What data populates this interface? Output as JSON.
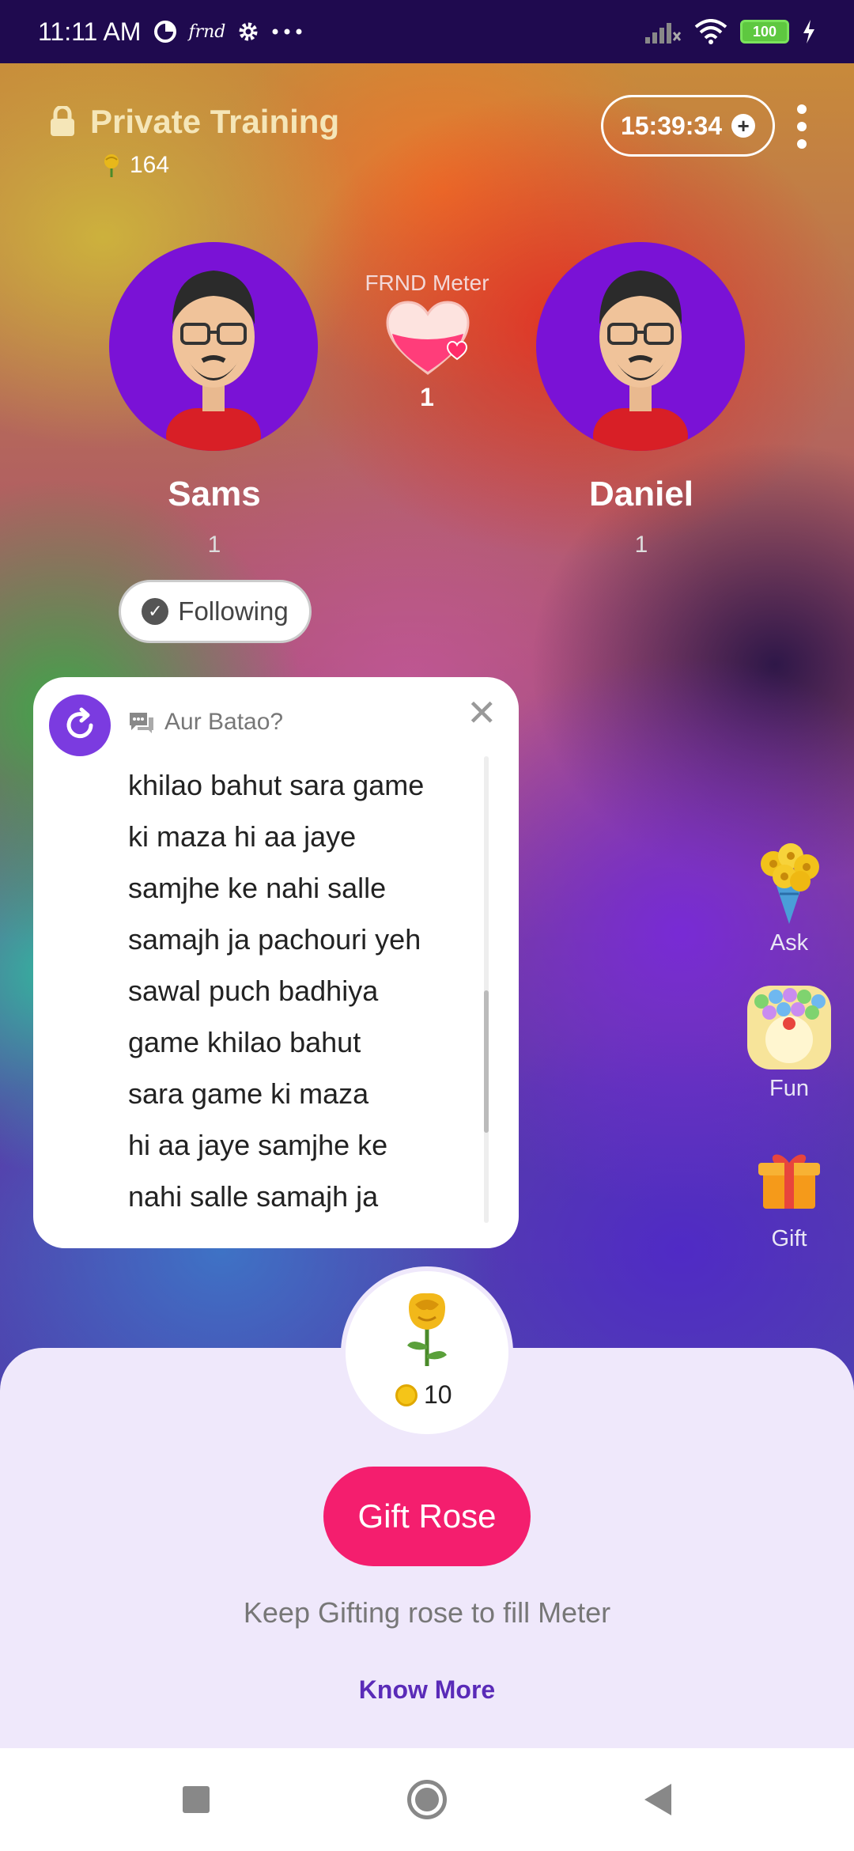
{
  "status_bar": {
    "time": "11:11 AM",
    "app_mark": "frnd",
    "battery": "100",
    "icons": [
      "data-saver-icon",
      "gear-icon",
      "more-dots-icon",
      "signal-icon",
      "wifi-icon",
      "battery-icon",
      "charging-icon"
    ]
  },
  "header": {
    "title": "Private Training",
    "rose_count": "164",
    "timer": "15:39:34"
  },
  "meter": {
    "label": "FRND Meter",
    "count": "1"
  },
  "users": [
    {
      "name": "Sams",
      "count": "1"
    },
    {
      "name": "Daniel",
      "count": "1"
    }
  ],
  "follow_button": {
    "label": "Following"
  },
  "question_card": {
    "title": "Aur Batao?",
    "lines": [
      "khilao bahut sara game",
      "ki maza hi aa jaye",
      "samjhe ke nahi salle",
      "samajh ja pachouri yeh",
      "sawal puch badhiya",
      "game khilao bahut",
      "sara game ki maza",
      "hi aa jaye samjhe ke",
      "nahi salle samajh ja"
    ]
  },
  "side_actions": [
    {
      "label": "Ask",
      "icon": "bouquet-icon"
    },
    {
      "label": "Fun",
      "icon": "bubble-game-icon"
    },
    {
      "label": "Gift",
      "icon": "gift-box-icon"
    }
  ],
  "sheet": {
    "rose_cost": "10",
    "gift_button": "Gift Rose",
    "hint": "Keep Gifting rose to fill Meter",
    "know_more": "Know More"
  },
  "colors": {
    "status_bar": "#1f0a4f",
    "avatar_bg": "#7a12d6",
    "gift_button": "#f41e6e",
    "know_more": "#5a2bb8",
    "sheet_bg": "#efe8fb",
    "refresh_button": "#7b3be0"
  }
}
